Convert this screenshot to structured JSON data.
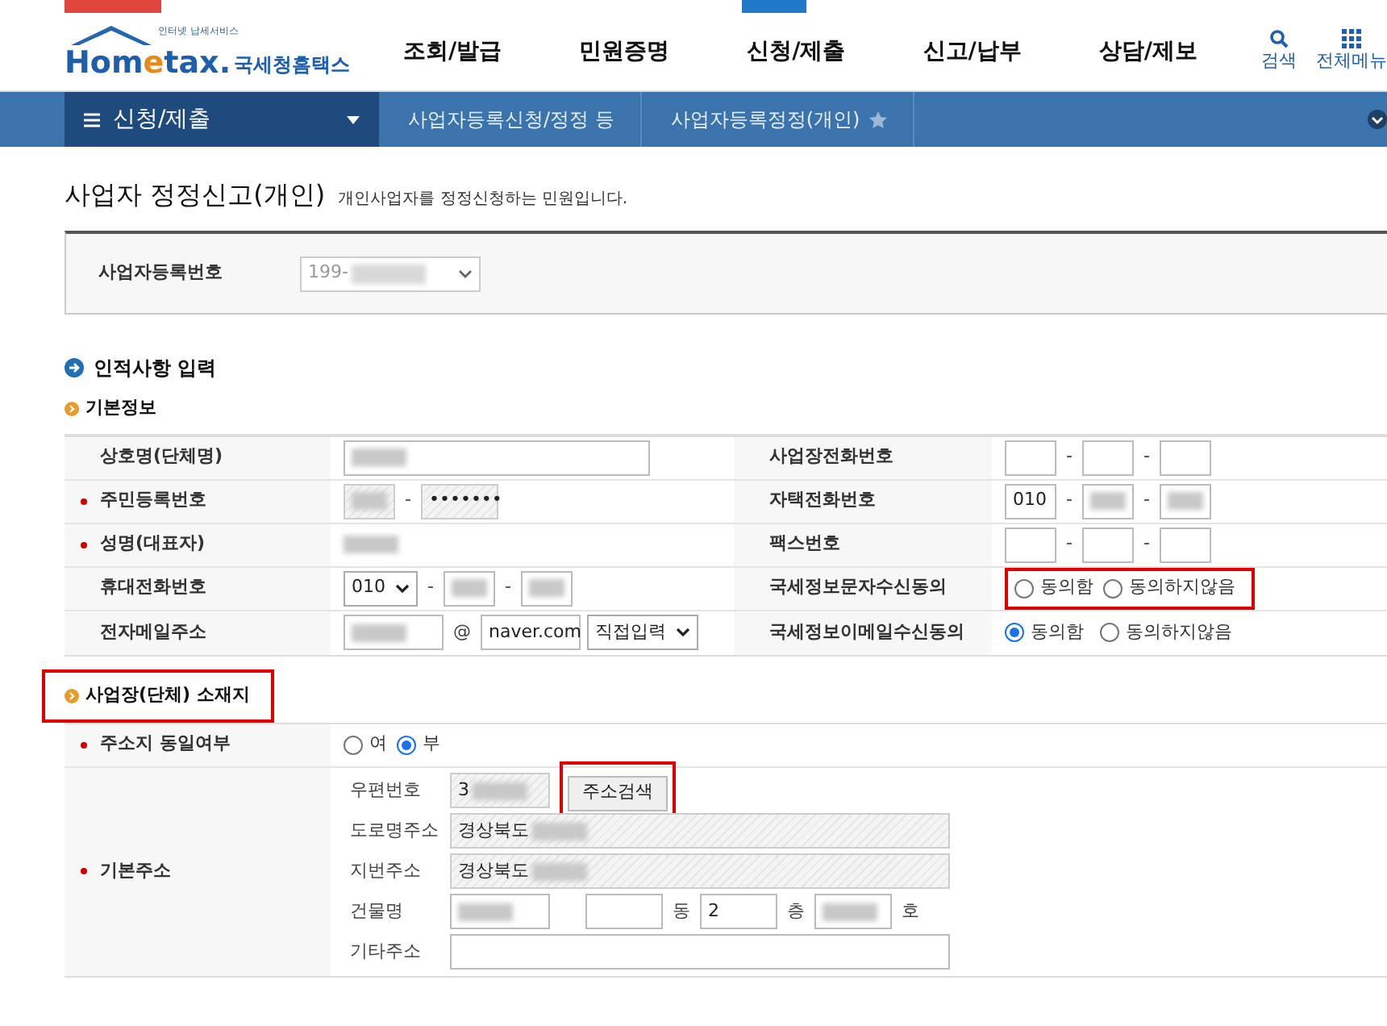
{
  "header": {
    "logo": {
      "tagline": "인터넷 납세서비스",
      "brand_a": "Hom",
      "brand_b": "e",
      "brand_c": "tax.",
      "brand_ko": "국세청홈택스"
    },
    "nav": [
      "조회/발급",
      "민원증명",
      "신청/제출",
      "신고/납부",
      "상담/제보"
    ],
    "tools": [
      {
        "kind": "search",
        "label": "검색"
      },
      {
        "kind": "grid",
        "label": "전체메뉴"
      }
    ]
  },
  "breadcrumb": {
    "menu": "신청/제출",
    "crumbs": [
      {
        "label": "사업자등록신청/정정 등",
        "starred": false
      },
      {
        "label": "사업자등록정정(개인)",
        "starred": true
      }
    ]
  },
  "page": {
    "title": "사업자 정정신고(개인)",
    "subtitle": "개인사업자를 정정신청하는 민원입니다."
  },
  "business_number": {
    "label": "사업자등록번호",
    "value": "199-",
    "blurred": true
  },
  "section": {
    "title": "인적사항 입력",
    "subtitle": "기본정보"
  },
  "basic_info": [
    {
      "left": {
        "label": "상호명(단체명)",
        "required": false,
        "items": [
          {
            "kind": "wide",
            "blurred": true
          }
        ]
      },
      "right": {
        "label": "사업장전화번호",
        "required": false,
        "items": [
          {
            "kind": "input"
          },
          {
            "kind": "sep",
            "text": "-"
          },
          {
            "kind": "input"
          },
          {
            "kind": "sep",
            "text": "-"
          },
          {
            "kind": "input"
          }
        ]
      }
    },
    {
      "left": {
        "label": "주민등록번호",
        "required": true,
        "items": [
          {
            "kind": "input",
            "readonly": true,
            "blurred": true
          },
          {
            "kind": "sep",
            "text": "-"
          },
          {
            "kind": "short",
            "readonly": true,
            "value": "•••••••"
          }
        ]
      },
      "right": {
        "label": "자택전화번호",
        "required": false,
        "items": [
          {
            "kind": "input",
            "value": "010"
          },
          {
            "kind": "sep",
            "text": "-"
          },
          {
            "kind": "input",
            "blurred": true
          },
          {
            "kind": "sep",
            "text": "-"
          },
          {
            "kind": "input",
            "blurred": true
          }
        ]
      }
    },
    {
      "left": {
        "label": "성명(대표자)",
        "required": true,
        "items": [
          {
            "kind": "plain",
            "blurred": true
          }
        ]
      },
      "right": {
        "label": "팩스번호",
        "required": false,
        "items": [
          {
            "kind": "input"
          },
          {
            "kind": "sep",
            "text": "-"
          },
          {
            "kind": "input"
          },
          {
            "kind": "sep",
            "text": "-"
          },
          {
            "kind": "input"
          }
        ]
      }
    },
    {
      "left": {
        "label": "휴대전화번호",
        "required": false,
        "items": [
          {
            "kind": "select",
            "value": "010"
          },
          {
            "kind": "sep",
            "text": "-"
          },
          {
            "kind": "input",
            "blurred": true
          },
          {
            "kind": "sep",
            "text": "-"
          },
          {
            "kind": "input",
            "blurred": true
          }
        ]
      },
      "right": {
        "label": "국세정보문자수신동의",
        "required": false,
        "highlighted": true,
        "items": [
          {
            "kind": "radio",
            "label": "동의함",
            "selected": false
          },
          {
            "kind": "radio",
            "label": "동의하지않음",
            "selected": false
          }
        ]
      }
    },
    {
      "left": {
        "label": "전자메일주소",
        "required": false,
        "items": [
          {
            "kind": "mid",
            "blurred": true
          },
          {
            "kind": "sep",
            "text": "@"
          },
          {
            "kind": "mid",
            "value": "naver.com"
          },
          {
            "kind": "select",
            "value": "직접입력"
          }
        ]
      },
      "right": {
        "label": "국세정보이메일수신동의",
        "required": false,
        "items": [
          {
            "kind": "radio",
            "label": "동의함",
            "selected": true
          },
          {
            "kind": "radio",
            "label": "동의하지않음",
            "selected": false
          }
        ]
      }
    }
  ],
  "address": {
    "title": "사업장(단체) 소재지",
    "highlighted": true,
    "same": {
      "label": "주소지 동일여부",
      "required": true,
      "options": [
        {
          "label": "여",
          "selected": false
        },
        {
          "label": "부",
          "selected": true
        }
      ]
    },
    "basic": {
      "label": "기본주소",
      "required": true,
      "rows": [
        {
          "label": "우편번호",
          "items": [
            {
              "kind": "mid",
              "readonly": true,
              "value": "3",
              "blurred": true
            },
            {
              "kind": "button",
              "text": "주소검색",
              "highlighted": true
            }
          ]
        },
        {
          "label": "도로명주소",
          "items": [
            {
              "kind": "full",
              "readonly": true,
              "value": "경상북도",
              "blurred": true
            }
          ]
        },
        {
          "label": "지번주소",
          "items": [
            {
              "kind": "full",
              "readonly": true,
              "value": "경상북도",
              "blurred": true
            }
          ]
        },
        {
          "label": "건물명",
          "items": [
            {
              "kind": "mid",
              "blurred": true
            },
            {
              "kind": "gap"
            },
            {
              "kind": "short"
            },
            {
              "kind": "sep",
              "text": "동"
            },
            {
              "kind": "short",
              "value": "2"
            },
            {
              "kind": "sep",
              "text": "층"
            },
            {
              "kind": "short",
              "blurred": true
            },
            {
              "kind": "sep",
              "text": "호"
            }
          ]
        },
        {
          "label": "기타주소",
          "items": [
            {
              "kind": "full"
            }
          ]
        }
      ]
    }
  }
}
